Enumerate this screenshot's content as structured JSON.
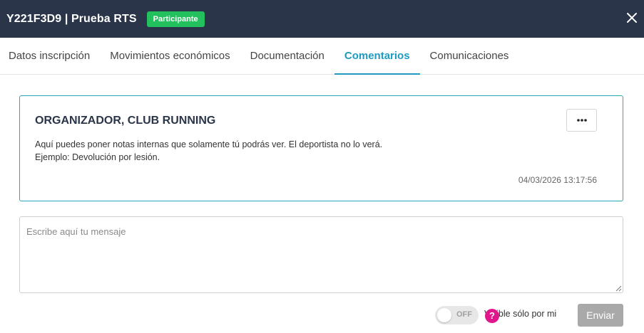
{
  "header": {
    "title": "Y221F3D9 | Prueba RTS",
    "badge": "Participante",
    "close_icon": "close-icon"
  },
  "colors": {
    "header_bg": "#2a3549",
    "badge_bg": "#22c15e",
    "accent": "#1d9bc0",
    "help": "#e0178c"
  },
  "tabs": [
    {
      "label": "Datos inscripción",
      "active": false
    },
    {
      "label": "Movimientos económicos",
      "active": false
    },
    {
      "label": "Documentación",
      "active": false
    },
    {
      "label": "Comentarios",
      "active": true
    },
    {
      "label": "Comunicaciones",
      "active": false
    }
  ],
  "comment": {
    "author": "ORGANIZADOR, CLUB RUNNING",
    "line1": "Aquí puedes poner notas internas que solamente tú podrás ver. El deportista no lo verá.",
    "line2": "Ejemplo: Devolución por lesión.",
    "date": "04/03/2026 13:17:56",
    "more_icon": "more-horizontal-icon"
  },
  "composer": {
    "placeholder": "Escribe aquí tu mensaje",
    "value": ""
  },
  "visibility": {
    "toggle_state": "OFF",
    "label": "Visible sólo por mi",
    "help_glyph": "?"
  },
  "send_label": "Enviar"
}
